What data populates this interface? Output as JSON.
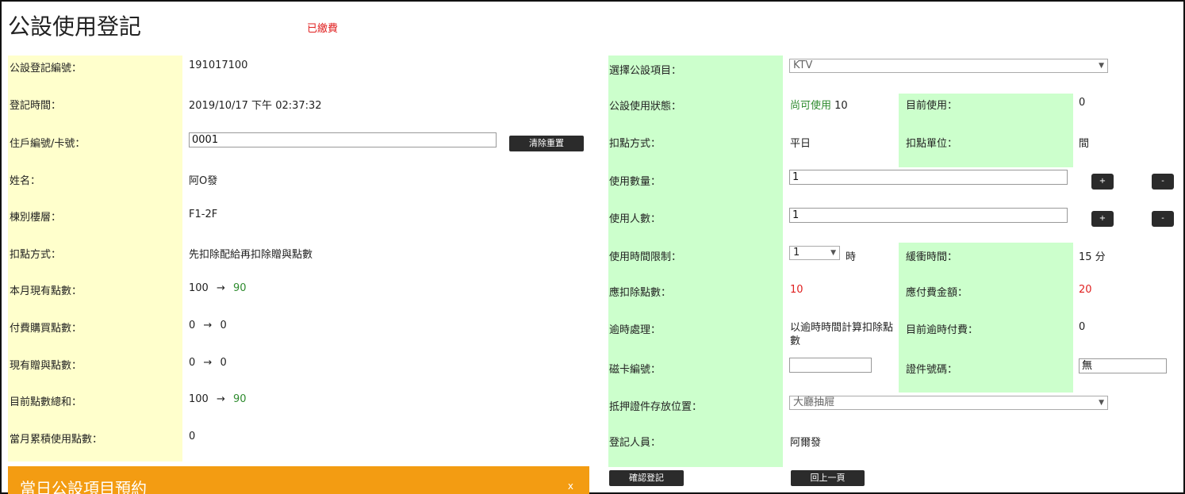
{
  "header": {
    "title": "公設使用登記",
    "status": "已繳費"
  },
  "left": {
    "rows": [
      {
        "label": "公設登記編號：",
        "value": "191017100"
      },
      {
        "label": "登記時間：",
        "value": "2019/10/17 下午 02:37:32"
      },
      {
        "label": "住戶編號/卡號：",
        "input_value": "0001",
        "button": "清除重置"
      },
      {
        "label": "姓名：",
        "value": "阿O發"
      },
      {
        "label": "棟別樓層：",
        "value": "F1-2F"
      },
      {
        "label": "扣點方式：",
        "value": "先扣除配給再扣除贈與點數"
      },
      {
        "label": "本月現有點數：",
        "from": "100",
        "arrow": "→",
        "to": "90"
      },
      {
        "label": "付費購買點數：",
        "from": "0",
        "arrow": "→",
        "to": "0"
      },
      {
        "label": "現有贈與點數：",
        "from": "0",
        "arrow": "→",
        "to": "0"
      },
      {
        "label": "目前點數總和：",
        "from": "100",
        "arrow": "→",
        "to": "90"
      },
      {
        "label": "當月累積使用點數：",
        "value": "0"
      }
    ]
  },
  "right": {
    "facility_label": "選擇公設項目：",
    "facility_value": "KTV",
    "status_label": "公設使用狀態：",
    "status_text": "尚可使用",
    "status_count": "10",
    "current_use_label": "目前使用：",
    "current_use_value": "0",
    "deduct_method_label": "扣點方式：",
    "deduct_method_value": "平日",
    "deduct_unit_label": "扣點單位：",
    "deduct_unit_value": "間",
    "quantity_label": "使用數量：",
    "quantity_value": "1",
    "people_label": "使用人數：",
    "people_value": "1",
    "plus": "+",
    "minus": "-",
    "time_limit_label": "使用時間限制：",
    "time_limit_value": "1",
    "time_unit": "時",
    "buffer_label": "緩衝時間：",
    "buffer_value": "15 分",
    "deduct_points_label": "應扣除點數：",
    "deduct_points_value": "10",
    "fee_label": "應付費金額：",
    "fee_value": "20",
    "overtime_label": "逾時處理：",
    "overtime_value": "以逾時時間計算扣除點數",
    "overtime_fee_label": "目前逾時付費：",
    "overtime_fee_value": "0",
    "card_label": "磁卡編號：",
    "card_value": "",
    "id_label": "證件號碼：",
    "id_value": "無",
    "deposit_label": "抵押證件存放位置：",
    "deposit_value": "大廳抽屜",
    "registrar_label": "登記人員：",
    "registrar_value": "阿爾發",
    "confirm_button": "確認登記",
    "back_button": "回上一頁"
  },
  "booking": {
    "title": "當日公設項目預約",
    "close": "x"
  }
}
